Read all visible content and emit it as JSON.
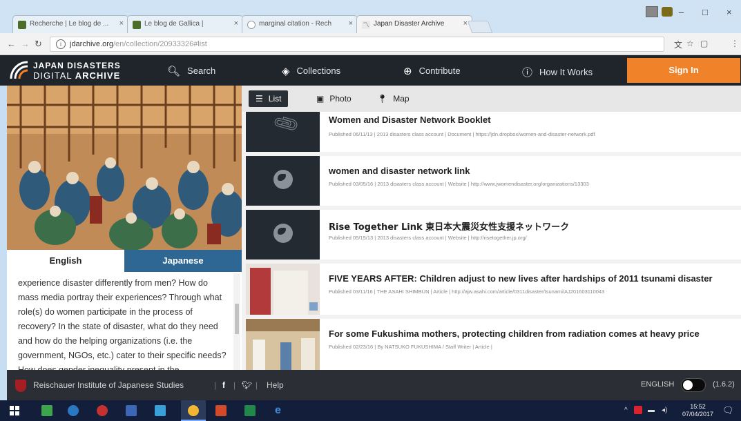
{
  "browser": {
    "tabs": [
      {
        "label": "Recherche | Le blog de ..."
      },
      {
        "label": "Le blog de Gallica |"
      },
      {
        "label": "marginal citation - Rech"
      },
      {
        "label": "Japan Disaster Archive"
      }
    ],
    "url": "jdarchive.org",
    "url_path": "/en/collection/20933326#list"
  },
  "site": {
    "logo_line1": "JAPAN DISASTERS",
    "logo_line2a": "DIGITAL ",
    "logo_line2b": "ARCHIVE",
    "nav": {
      "search": "Search",
      "collections": "Collections",
      "contribute": "Contribute",
      "how_it_works": "How It Works",
      "sign_in": "Sign In"
    }
  },
  "left_panel": {
    "tab_english": "English",
    "tab_japanese": "Japanese",
    "description": "experience disaster differently from men? How do mass media portray their experiences? Through what role(s) do women participate in the process of recovery? In the state of disaster, what do they need and how do the helping organizations (i.e. the government, NGOs, etc.) cater to their specific needs? How does gender inequality present in the"
  },
  "view_tabs": {
    "list": "List",
    "photo": "Photo",
    "map": "Map"
  },
  "results": [
    {
      "title": "Women and Disaster Network Booklet",
      "meta": "Published 06/11/13 | 2013 disasters class account | Document | https://jdn.dropbox/women-and-disaster-network.pdf",
      "thumb": "paperclip-icon"
    },
    {
      "title": "women and disaster network link",
      "meta": "Published 03/05/16 | 2013 disasters class account | Website | http://www.jwomendisaster.org/organizations/13303",
      "thumb": "globe-icon"
    },
    {
      "title": "Rise Together Link 東日本大震災女性支援ネットワーク",
      "meta": "Published 05/15/13 | 2013 disasters class account | Website | http://risetogether.jp.org/",
      "thumb": "globe-icon"
    },
    {
      "title": "FIVE YEARS AFTER: Children adjust to new lives after hardships of 2011 tsunami disaster",
      "meta": "Published 03/11/16 | THE ASAHI SHIMBUN | Article | http://ajw.asahi.com/article/0311disaster/tsunami/AJ201603110043",
      "thumb": "photo"
    },
    {
      "title": "For some Fukushima mothers, protecting children from radiation comes at heavy price",
      "meta": "Published 02/23/16 | By NATSUKO FUKUSHIMA / Staff Writer | Article |",
      "thumb": "photo"
    }
  ],
  "footer": {
    "institute": "Reischauer Institute of Japanese Studies",
    "help": "Help",
    "language": "ENGLISH",
    "version": "(1.6.2)"
  },
  "taskbar": {
    "time": "15:52",
    "date": "07/04/2017"
  },
  "colors": {
    "header_bg": "#20252c",
    "sign_in": "#f0832a",
    "japanese_tab": "#2e6794"
  }
}
